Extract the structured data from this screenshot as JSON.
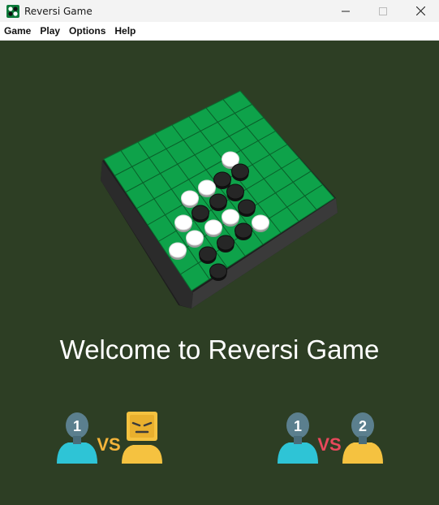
{
  "window": {
    "title": "Reversi Game"
  },
  "menu": {
    "items": [
      "Game",
      "Play",
      "Options",
      "Help"
    ]
  },
  "main": {
    "welcome_text": "Welcome to Reversi Game",
    "vs_cpu": {
      "player_number": "1",
      "vs_text": "VS"
    },
    "vs_player": {
      "player1_number": "1",
      "player2_number": "2",
      "vs_text": "VS"
    }
  },
  "colors": {
    "background": "#2d3e24",
    "board_green": "#0ea24a",
    "titlebar": "#f3f3f3",
    "vs_cpu_text": "#f5b43a",
    "vs_player_text": "#e8485c"
  }
}
